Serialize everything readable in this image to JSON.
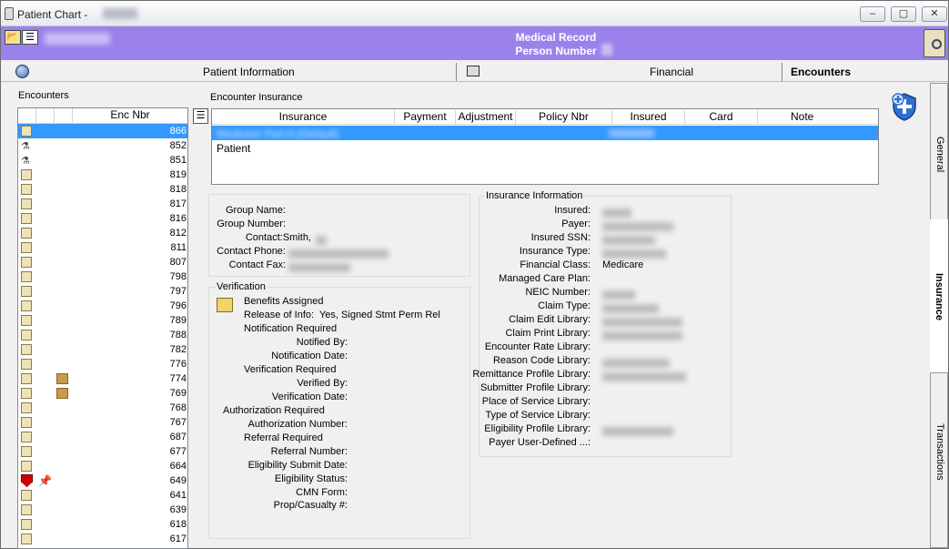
{
  "window": {
    "title": "Patient Chart -",
    "buttons": [
      "–",
      "▢",
      "✕"
    ]
  },
  "header": {
    "medical_record_label": "Medical Record",
    "person_number_label": "Person Number"
  },
  "tabs": [
    {
      "label": "Patient Information",
      "active": false
    },
    {
      "label": "Financial",
      "active": false
    },
    {
      "label": "Encounters",
      "active": true
    }
  ],
  "side_tabs": [
    "General",
    "Insurance",
    "Transactions"
  ],
  "encounters": {
    "section_label": "Encounters",
    "column_header": "Enc Nbr",
    "rows": [
      {
        "num": "866",
        "icon": "document-icon",
        "selected": true
      },
      {
        "num": "852",
        "icon": "pill-icon"
      },
      {
        "num": "851",
        "icon": "pill-icon"
      },
      {
        "num": "819",
        "icon": "document-icon"
      },
      {
        "num": "818",
        "icon": "document-icon"
      },
      {
        "num": "817",
        "icon": "document-icon"
      },
      {
        "num": "816",
        "icon": "document-icon"
      },
      {
        "num": "812",
        "icon": "document-icon"
      },
      {
        "num": "811",
        "icon": "document-icon"
      },
      {
        "num": "807",
        "icon": "document-icon"
      },
      {
        "num": "798",
        "icon": "document-icon"
      },
      {
        "num": "797",
        "icon": "document-icon"
      },
      {
        "num": "796",
        "icon": "document-icon"
      },
      {
        "num": "789",
        "icon": "document-icon"
      },
      {
        "num": "788",
        "icon": "document-icon"
      },
      {
        "num": "782",
        "icon": "document-icon"
      },
      {
        "num": "776",
        "icon": "document-icon"
      },
      {
        "num": "774",
        "icon": "document-icon",
        "extra": "box-icon"
      },
      {
        "num": "769",
        "icon": "document-icon",
        "extra": "box-icon"
      },
      {
        "num": "768",
        "icon": "document-icon"
      },
      {
        "num": "767",
        "icon": "document-icon"
      },
      {
        "num": "687",
        "icon": "document-icon"
      },
      {
        "num": "677",
        "icon": "document-icon"
      },
      {
        "num": "664",
        "icon": "document-icon"
      },
      {
        "num": "649",
        "icon": "red-flag-icon",
        "extra": "pin-icon"
      },
      {
        "num": "641",
        "icon": "document-icon"
      },
      {
        "num": "639",
        "icon": "document-icon"
      },
      {
        "num": "618",
        "icon": "document-icon"
      },
      {
        "num": "617",
        "icon": "document-icon"
      }
    ]
  },
  "encounter_insurance": {
    "section_label": "Encounter Insurance",
    "columns": [
      "Insurance",
      "Payment",
      "Adjustment",
      "Policy Nbr",
      "Insured",
      "Card",
      "Note"
    ],
    "rows": [
      {
        "insurance": "Medicare Part A (Default)",
        "insured": "",
        "selected": true
      },
      {
        "insurance": "Patient",
        "insured": "",
        "selected": false
      }
    ]
  },
  "group": {
    "group_name_label": "Group Name:",
    "group_number_label": "Group Number:",
    "contact_label": "Contact:",
    "contact_value": "Smith,",
    "contact_phone_label": "Contact Phone:",
    "contact_fax_label": "Contact Fax:"
  },
  "verification": {
    "legend": "Verification",
    "benefits_assigned": "Benefits Assigned",
    "release_label": "Release of Info:",
    "release_value": "Yes, Signed Stmt Perm Rel",
    "notification_required": "Notification Required",
    "notified_by": "Notified By:",
    "notification_date": "Notification Date:",
    "verification_required": "Verification Required",
    "verified_by": "Verified By:",
    "verification_date": "Verification Date:",
    "authorization_required": "Authorization Required",
    "authorization_number": "Authorization Number:",
    "referral_required": "Referral Required",
    "referral_number": "Referral Number:",
    "eligibility_submit_date": "Eligibility Submit Date:",
    "eligibility_status": "Eligibility Status:",
    "cmn_form": "CMN Form:",
    "prop_casualty": "Prop/Casualty #:"
  },
  "insurance_info": {
    "legend": "Insurance Information",
    "fields": [
      {
        "label": "Insured:",
        "value": "",
        "blurred": true
      },
      {
        "label": "Payer:",
        "value": "",
        "blurred": true
      },
      {
        "label": "Insured SSN:",
        "value": "",
        "blurred": true
      },
      {
        "label": "Insurance Type:",
        "value": "",
        "blurred": true
      },
      {
        "label": "Financial Class:",
        "value": "Medicare",
        "blurred": false
      },
      {
        "label": "Managed Care Plan:",
        "value": "",
        "blurred": false
      },
      {
        "label": "NEIC Number:",
        "value": "",
        "blurred": true
      },
      {
        "label": "Claim Type:",
        "value": "",
        "blurred": true
      },
      {
        "label": "Claim Edit Library:",
        "value": "",
        "blurred": true
      },
      {
        "label": "Claim Print Library:",
        "value": "",
        "blurred": true
      },
      {
        "label": "Encounter Rate Library:",
        "value": "",
        "blurred": false
      },
      {
        "label": "Reason Code Library:",
        "value": "",
        "blurred": true
      },
      {
        "label": "Remittance Profile Library:",
        "value": "",
        "blurred": true
      },
      {
        "label": "Submitter Profile Library:",
        "value": "",
        "blurred": false
      },
      {
        "label": "Place of Service Library:",
        "value": "",
        "blurred": false
      },
      {
        "label": "Type of Service Library:",
        "value": "",
        "blurred": false
      },
      {
        "label": "Eligibility Profile Library:",
        "value": "",
        "blurred": true
      },
      {
        "label": "Payer User-Defined ...:",
        "value": "",
        "blurred": false
      }
    ]
  }
}
